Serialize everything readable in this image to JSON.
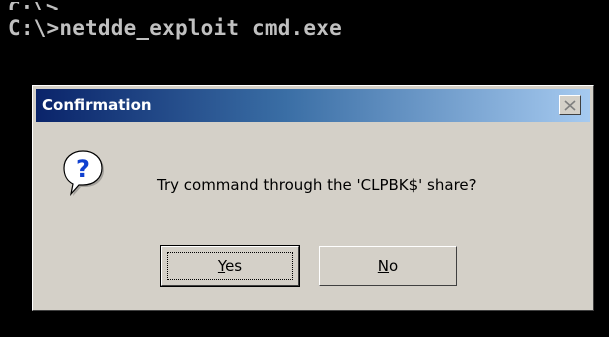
{
  "console": {
    "prev_line_fragment": "C:\\>",
    "command_line": "C:\\>netdde_exploit cmd.exe"
  },
  "dialog": {
    "title": "Confirmation",
    "message": "Try command through the 'CLPBK$' share?",
    "icon": "question-icon",
    "close_icon": "close-icon",
    "buttons": {
      "yes": {
        "mnemonic": "Y",
        "rest": "es"
      },
      "no": {
        "mnemonic": "N",
        "rest": "o"
      }
    }
  },
  "colors": {
    "console_bg": "#000000",
    "console_text": "#c0c0c0",
    "dialog_face": "#d4d0c8",
    "titlebar_start": "#0a246a",
    "titlebar_end": "#a6caf0",
    "question_blue": "#1040d0"
  }
}
